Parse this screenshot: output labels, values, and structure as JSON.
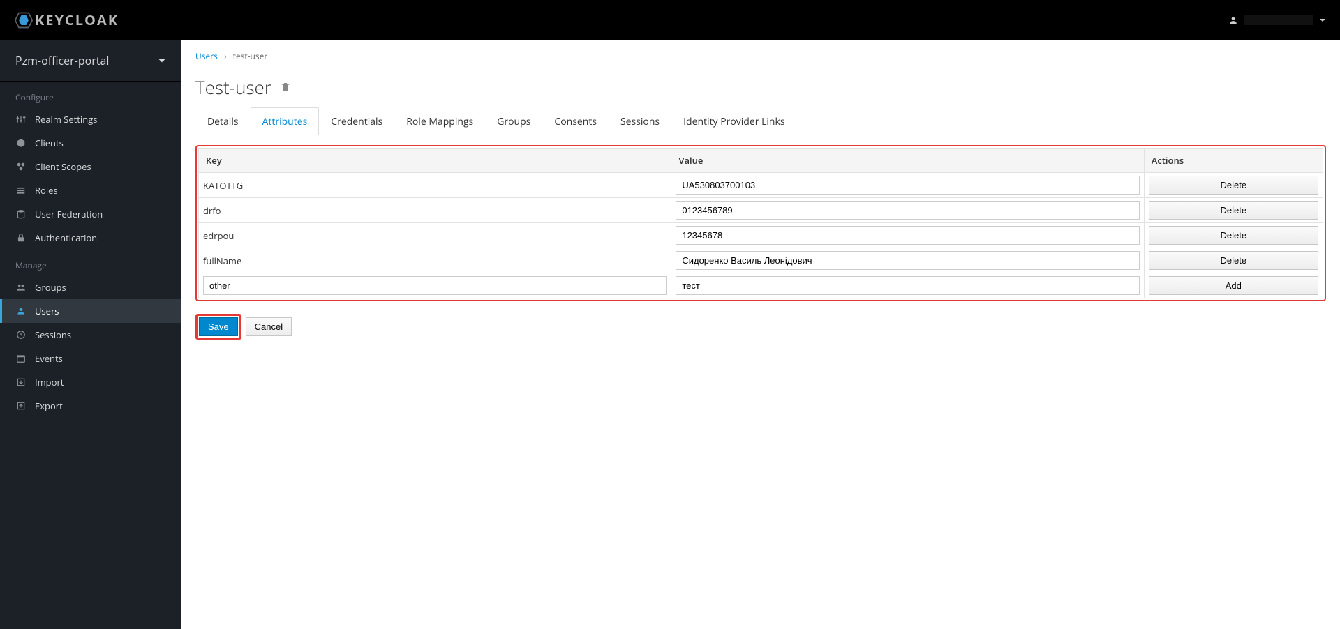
{
  "header": {
    "logo_text": "KEYCLOAK",
    "user_label": ""
  },
  "sidebar": {
    "realm": "Pzm-officer-portal",
    "sections": {
      "configure": {
        "title": "Configure",
        "items": [
          "Realm Settings",
          "Clients",
          "Client Scopes",
          "Roles",
          "User Federation",
          "Authentication"
        ]
      },
      "manage": {
        "title": "Manage",
        "items": [
          "Groups",
          "Users",
          "Sessions",
          "Events",
          "Import",
          "Export"
        ]
      }
    },
    "active_item": "Users"
  },
  "breadcrumb": {
    "root": "Users",
    "current": "test-user"
  },
  "page": {
    "title": "Test-user"
  },
  "tabs": {
    "items": [
      "Details",
      "Attributes",
      "Credentials",
      "Role Mappings",
      "Groups",
      "Consents",
      "Sessions",
      "Identity Provider Links"
    ],
    "active": "Attributes"
  },
  "table": {
    "headers": {
      "key": "Key",
      "value": "Value",
      "actions": "Actions"
    },
    "rows": [
      {
        "key": "KATOTTG",
        "value": "UA530803700103",
        "action": "Delete"
      },
      {
        "key": "drfo",
        "value": "0123456789",
        "action": "Delete"
      },
      {
        "key": "edrpou",
        "value": "12345678",
        "action": "Delete"
      },
      {
        "key": "fullName",
        "value": "Сидоренко Василь Леонідович",
        "action": "Delete"
      }
    ],
    "new_row": {
      "key": "other",
      "value": "тест",
      "action": "Add"
    }
  },
  "actions": {
    "save": "Save",
    "cancel": "Cancel"
  }
}
